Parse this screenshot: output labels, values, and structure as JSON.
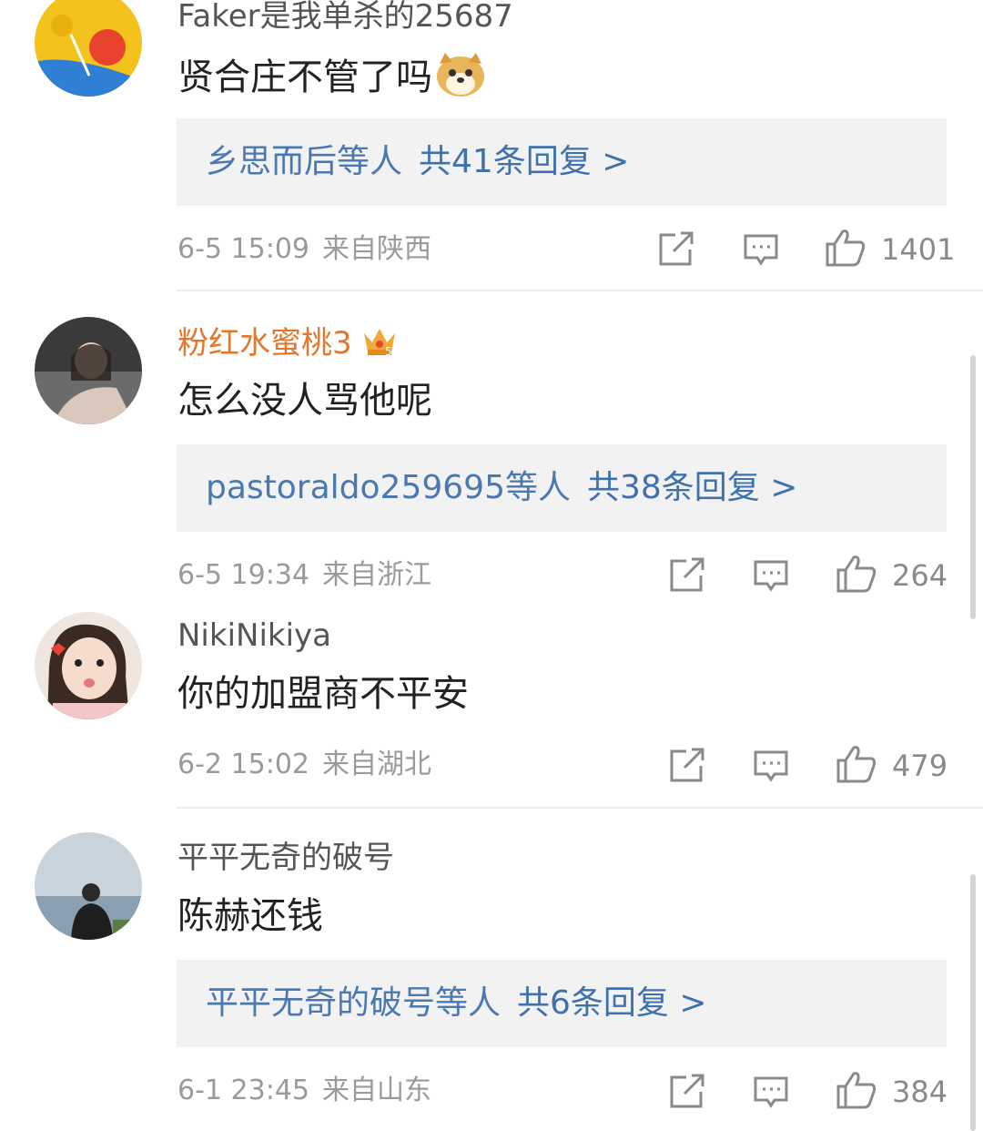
{
  "comments": [
    {
      "username": "Faker是我单杀的25687",
      "text": "贤合庄不管了吗",
      "emoji": "doge-emoji",
      "replies": {
        "who": "乡思而后",
        "etc": "等人",
        "count": "共41条回复 >"
      },
      "date": "6-5 15:09",
      "location": "来自陕西",
      "likes": "1401"
    },
    {
      "username": "粉红水蜜桃3",
      "badge": "crown-icon",
      "text": "怎么没人骂他呢",
      "replies": {
        "who": "pastoraldo259695",
        "etc": "等人",
        "count": "共38条回复 >"
      },
      "date": "6-5 19:34",
      "location": "来自浙江",
      "likes": "264"
    },
    {
      "username": "NikiNikiya",
      "text": "你的加盟商不平安",
      "date": "6-2 15:02",
      "location": "来自湖北",
      "likes": "479"
    },
    {
      "username": "平平无奇的破号",
      "text": "陈赫还钱",
      "replies": {
        "who": "平平无奇的破号",
        "etc": "等人",
        "count": "共6条回复 >"
      },
      "date": "6-1 23:45",
      "location": "来自山东",
      "likes": "384"
    }
  ],
  "colors": {
    "link": "#4a78b0",
    "vip_name": "#e5762a",
    "meta": "#9a9a9a",
    "reply_bg": "#f2f2f2"
  }
}
